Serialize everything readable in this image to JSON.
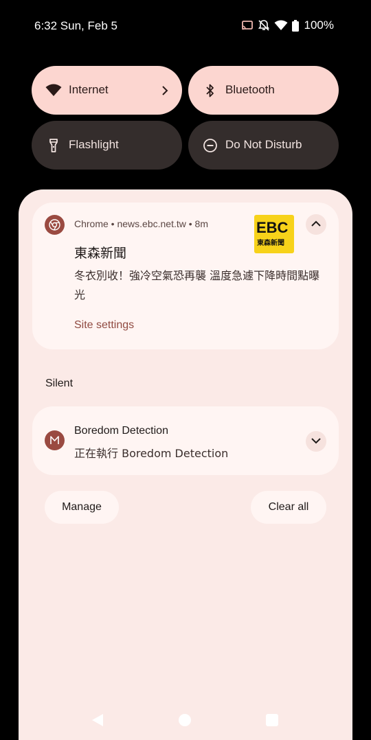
{
  "status_bar": {
    "time_date": "6:32 Sun, Feb 5",
    "battery": "100%",
    "icons": [
      "cast-icon",
      "bell-off-icon",
      "wifi-icon",
      "battery-icon"
    ]
  },
  "quick_settings": {
    "tiles": [
      {
        "label": "Internet",
        "icon": "wifi-icon",
        "active": true
      },
      {
        "label": "Bluetooth",
        "icon": "bluetooth-icon",
        "active": true
      },
      {
        "label": "Flashlight",
        "icon": "flashlight-icon",
        "active": false
      },
      {
        "label": "Do Not Disturb",
        "icon": "do-not-disturb-icon",
        "active": false
      }
    ]
  },
  "notifications": {
    "chrome": {
      "meta": "Chrome • news.ebc.net.tw • 8m",
      "title": "東森新聞",
      "text": "冬衣別收！強冷空氣恐再襲 溫度急遽下降時間點曝光",
      "action": "Site settings",
      "logo_text": "EBC",
      "logo_subtext": "東森新聞"
    },
    "section_label": "Silent",
    "boredom": {
      "title": "Boredom Detection",
      "subtitle": "正在執行 Boredom Detection"
    }
  },
  "actions": {
    "manage": "Manage",
    "clear_all": "Clear all"
  },
  "colors": {
    "tile_active": "#fcd6d0",
    "tile_inactive": "#342d2c",
    "sheet": "#fbeae7",
    "card": "#fff5f3",
    "accent": "#904a41"
  }
}
